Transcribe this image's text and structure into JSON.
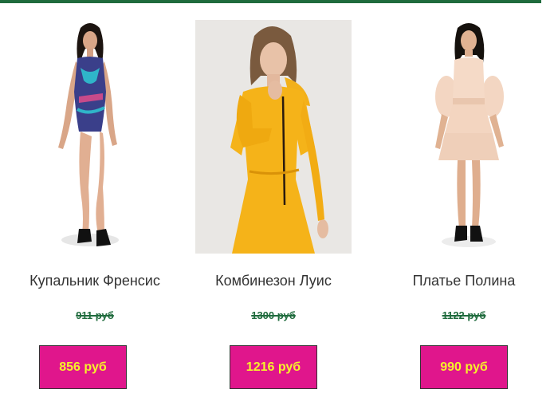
{
  "products": [
    {
      "name": "Купальник Френсис",
      "old_price": "911 руб",
      "price": "856 руб"
    },
    {
      "name": "Комбинезон Луис",
      "old_price": "1300 руб",
      "price": "1216 руб"
    },
    {
      "name": "Платье Полина",
      "old_price": "1122 руб",
      "price": "990 руб"
    }
  ],
  "colors": {
    "accent_rule": "#1f6b3d",
    "button_bg": "#e0168c",
    "button_text": "#f6f22a",
    "old_price": "#1f6b3d"
  }
}
